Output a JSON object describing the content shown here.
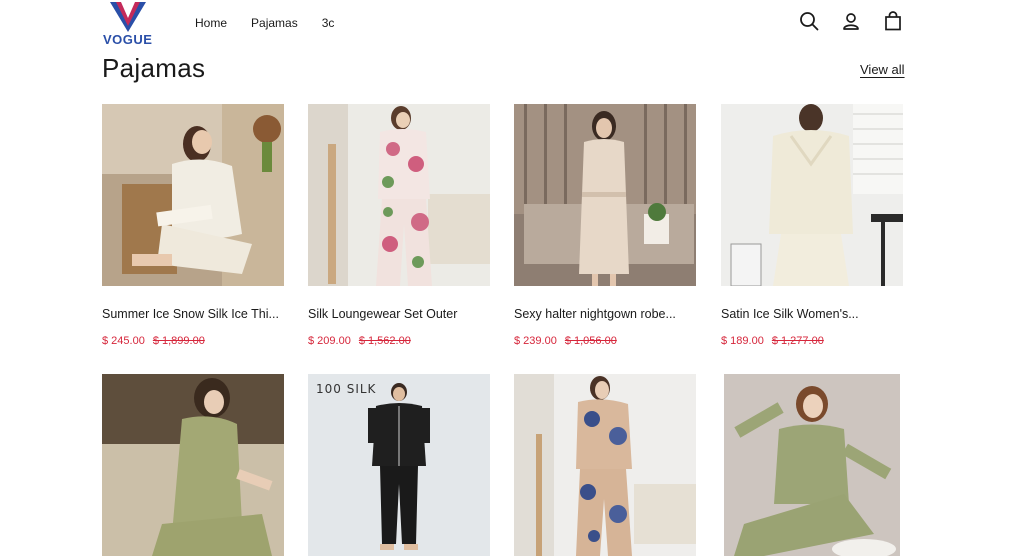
{
  "brand": {
    "name": "VOGUE"
  },
  "nav": {
    "items": [
      "Home",
      "Pajamas",
      "3c"
    ]
  },
  "header_icons": [
    "search-icon",
    "account-icon",
    "cart-icon"
  ],
  "section": {
    "title": "Pajamas",
    "view_all": "View all"
  },
  "products": [
    {
      "name": "Summer Ice Snow Silk Ice Thi...",
      "price": "$ 245.00",
      "compare_price": "$ 1,899.00"
    },
    {
      "name": "Silk Loungewear Set Outer",
      "price": "$ 209.00",
      "compare_price": "$ 1,562.00"
    },
    {
      "name": "Sexy halter nightgown robe...",
      "price": "$ 239.00",
      "compare_price": "$ 1,056.00"
    },
    {
      "name": "Satin Ice Silk Women's...",
      "price": "$ 189.00",
      "compare_price": "$ 1,277.00"
    },
    {
      "name": "",
      "price": "",
      "compare_price": ""
    },
    {
      "name": "",
      "price": "",
      "compare_price": "",
      "image_text": "100 SILK"
    },
    {
      "name": "",
      "price": "",
      "compare_price": ""
    },
    {
      "name": "",
      "price": "",
      "compare_price": ""
    }
  ],
  "colors": {
    "price": "#d6263b",
    "brand": "#2a4fa8",
    "brand_accent": "#c42a5a"
  }
}
